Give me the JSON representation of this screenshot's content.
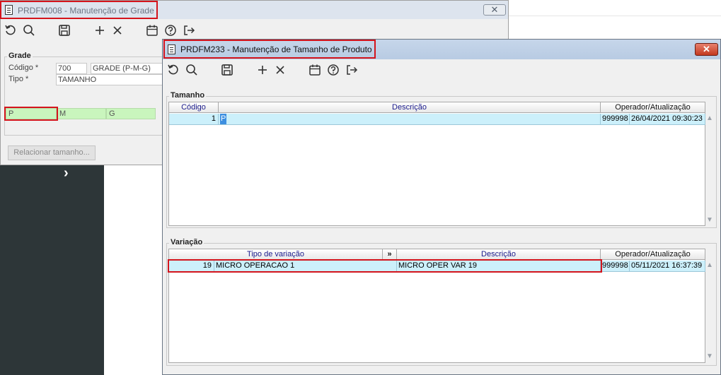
{
  "background_window": {
    "title": "PRDFM008 - Manutenção de Grade",
    "close_label": "✕",
    "section_legend": "Grade",
    "codigo_label": "Código *",
    "codigo_value": "700",
    "grade_desc_value": "GRADE (P-M-G)",
    "tipo_label": "Tipo *",
    "tipo_value": "TAMANHO",
    "sizes": [
      "P",
      "M",
      "G"
    ],
    "relacionar_button": "Relacionar tamanho..."
  },
  "sidebar": {
    "expand_glyph": "›"
  },
  "front_window": {
    "title": "PRDFM233 - Manutenção de Tamanho de Produto",
    "close_label": "✕",
    "tamanho": {
      "legend": "Tamanho",
      "columns": [
        "Código",
        "Descrição",
        "Operador/Atualização"
      ],
      "rows": [
        {
          "codigo": "1",
          "descricao": "P",
          "operador": "999998",
          "atualizacao": "26/04/2021 09:30:23"
        }
      ]
    },
    "variacao": {
      "legend": "Variação",
      "columns": [
        "Tipo de variação",
        "»",
        "Descrição",
        "Operador/Atualização"
      ],
      "rows": [
        {
          "codigo": "19",
          "tipo": "MICRO OPERACAO 1",
          "descricao": "MICRO OPER VAR 19",
          "operador": "999998",
          "atualizacao": "05/11/2021 16:37:39"
        }
      ]
    }
  },
  "colors": {
    "highlight_red": "#d4141c",
    "row_selected": "#ccf0fb",
    "size_green": "#c9f5bd",
    "sidebar_dark": "#2d3638"
  }
}
